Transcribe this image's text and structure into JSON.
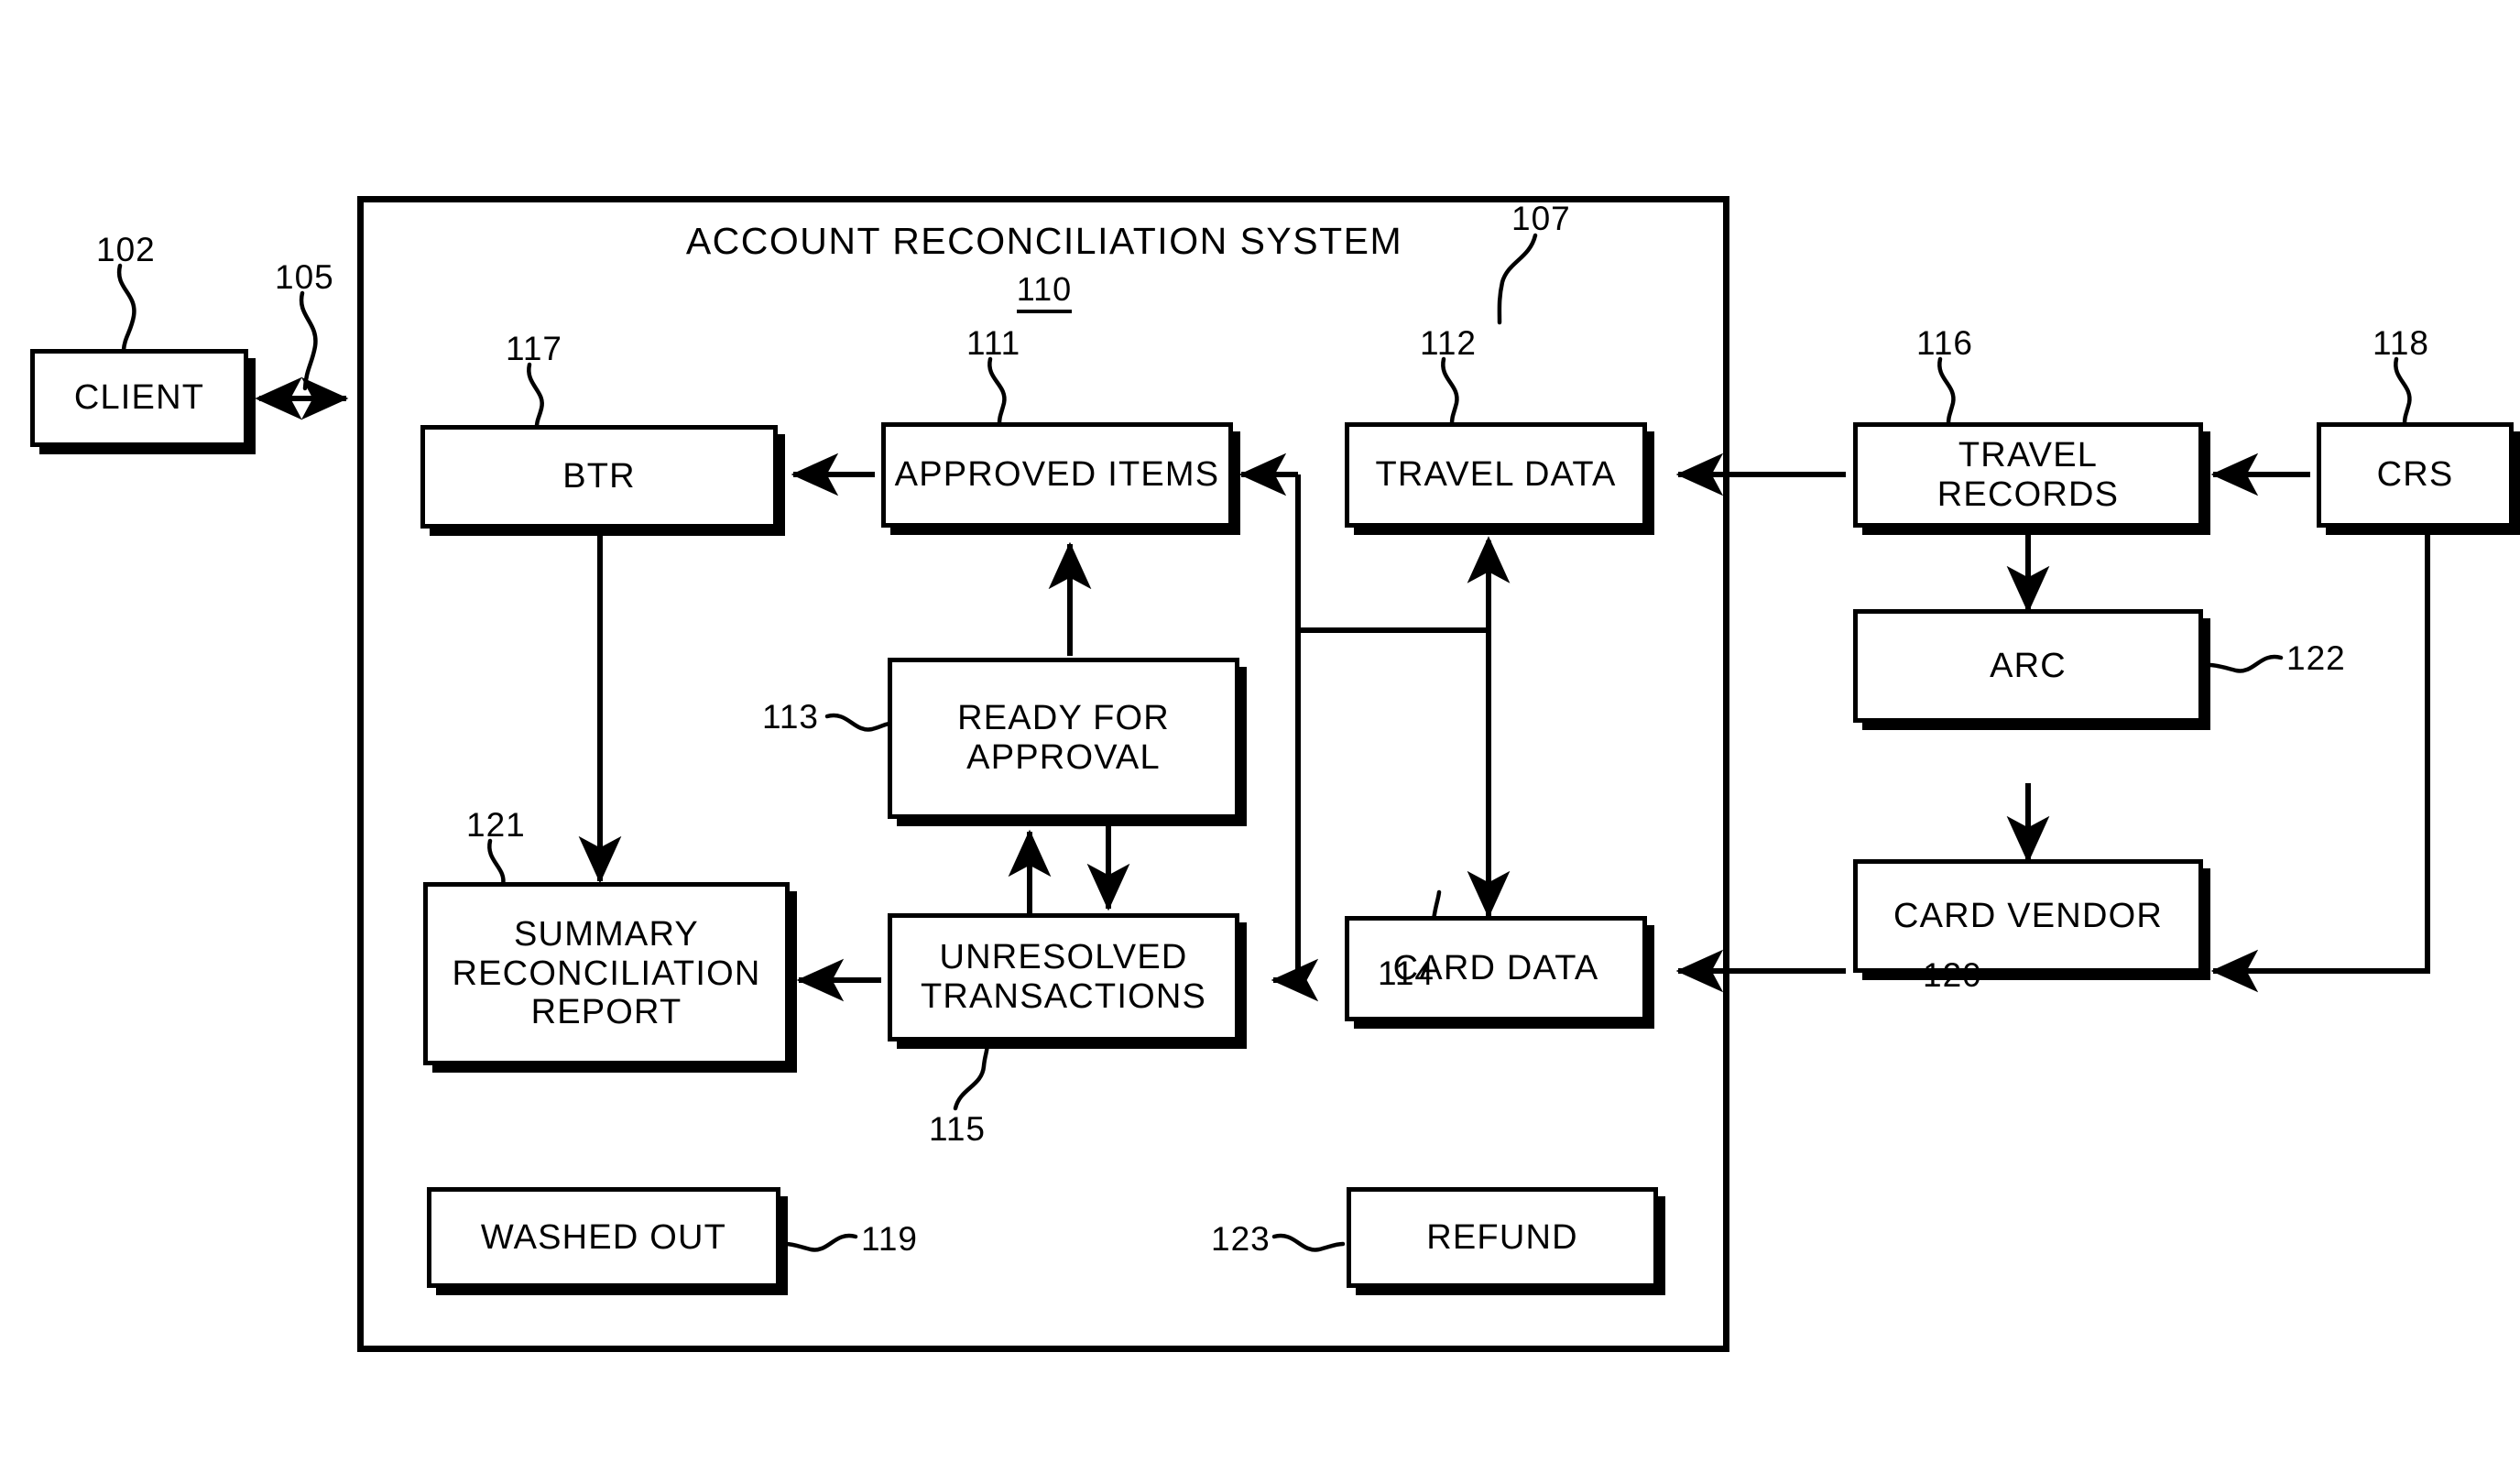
{
  "figure": {
    "kind": "patent-block-diagram",
    "system": {
      "title": "ACCOUNT RECONCILIATION SYSTEM",
      "ref": "110",
      "boundary_ref": "107"
    },
    "interface_ref": "105",
    "colors": {
      "stroke": "#000000",
      "fill": "#ffffff",
      "background": "#ffffff"
    },
    "nodes": [
      {
        "id": "client",
        "label": "CLIENT",
        "ref": "102",
        "ref_pos": "top-left"
      },
      {
        "id": "btr",
        "label": "BTR",
        "ref": "117",
        "ref_pos": "top-left"
      },
      {
        "id": "approved",
        "label": "APPROVED ITEMS",
        "ref": "111",
        "ref_pos": "top-center"
      },
      {
        "id": "ready",
        "label": "READY FOR\nAPPROVAL",
        "ref": "113",
        "ref_pos": "left"
      },
      {
        "id": "unresolved",
        "label": "UNRESOLVED\nTRANSACTIONS",
        "ref": "115",
        "ref_pos": "bottom-left"
      },
      {
        "id": "summary",
        "label": "SUMMARY\nRECONCILIATION\nREPORT",
        "ref": "121",
        "ref_pos": "top-left"
      },
      {
        "id": "washed",
        "label": "WASHED OUT",
        "ref": "119",
        "ref_pos": "right"
      },
      {
        "id": "refund",
        "label": "REFUND",
        "ref": "123",
        "ref_pos": "left"
      },
      {
        "id": "travel_data",
        "label": "TRAVEL DATA",
        "ref": "112",
        "ref_pos": "top-left"
      },
      {
        "id": "card_data",
        "label": "CARD DATA",
        "ref": "114",
        "ref_pos": "bottom-left"
      },
      {
        "id": "travel_records",
        "label": "TRAVEL RECORDS",
        "ref": "116",
        "ref_pos": "top-left"
      },
      {
        "id": "arc",
        "label": "ARC",
        "ref": "122",
        "ref_pos": "right"
      },
      {
        "id": "card_vendor",
        "label": "CARD VENDOR",
        "ref": "120",
        "ref_pos": "bottom-left"
      },
      {
        "id": "crs",
        "label": "CRS",
        "ref": "118",
        "ref_pos": "top-left"
      }
    ],
    "connections": [
      {
        "from": "client",
        "to": "system-boundary",
        "arrow": "both",
        "ref": "105"
      },
      {
        "from": "approved",
        "to": "btr",
        "arrow": "single"
      },
      {
        "from": "ready",
        "to": "approved",
        "arrow": "single"
      },
      {
        "from": "ready",
        "to": "unresolved",
        "arrow": "single"
      },
      {
        "from": "unresolved",
        "to": "ready",
        "arrow": "single"
      },
      {
        "from": "unresolved",
        "to": "summary",
        "arrow": "single"
      },
      {
        "from": "btr",
        "to": "summary",
        "arrow": "single"
      },
      {
        "from": "approved",
        "to": "unresolved",
        "arrow": "single",
        "routing": "right-side bus"
      },
      {
        "from": "travel_data",
        "to": "card_data",
        "arrow": "both"
      },
      {
        "from": "travel_records",
        "to": "travel_data",
        "arrow": "single"
      },
      {
        "from": "travel_records",
        "to": "arc",
        "arrow": "single"
      },
      {
        "from": "arc",
        "to": "card_vendor",
        "arrow": "single"
      },
      {
        "from": "card_vendor",
        "to": "card_data",
        "arrow": "single"
      },
      {
        "from": "crs",
        "to": "travel_records",
        "arrow": "single"
      },
      {
        "from": "crs",
        "to": "card_vendor",
        "arrow": "single"
      }
    ]
  },
  "labels": {
    "client": "CLIENT",
    "btr": "BTR",
    "approved_items": "APPROVED ITEMS",
    "ready_for_approval": "READY FOR\nAPPROVAL",
    "unresolved_transactions": "UNRESOLVED\nTRANSACTIONS",
    "summary_reconciliation_report": "SUMMARY\nRECONCILIATION\nREPORT",
    "washed_out": "WASHED OUT",
    "refund": "REFUND",
    "travel_data": "TRAVEL DATA",
    "card_data": "CARD DATA",
    "travel_records": "TRAVEL RECORDS",
    "arc": "ARC",
    "card_vendor": "CARD VENDOR",
    "crs": "CRS",
    "system_title": "ACCOUNT RECONCILIATION SYSTEM"
  },
  "refs": {
    "r102": "102",
    "r105": "105",
    "r107": "107",
    "r110": "110",
    "r111": "111",
    "r112": "112",
    "r113": "113",
    "r114": "114",
    "r115": "115",
    "r116": "116",
    "r117": "117",
    "r118": "118",
    "r119": "119",
    "r120": "120",
    "r121": "121",
    "r122": "122",
    "r123": "123"
  }
}
